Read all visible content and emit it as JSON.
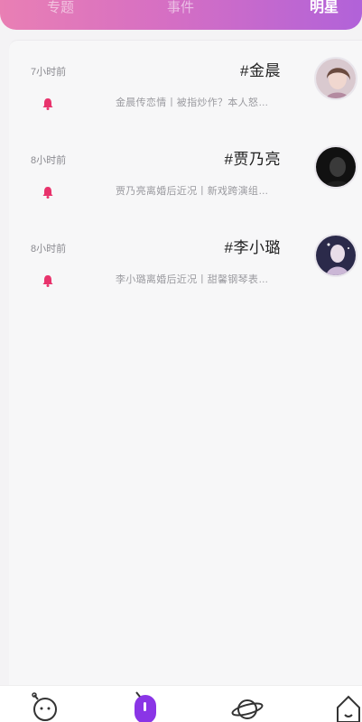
{
  "header": {
    "tabs": [
      {
        "label": "专题",
        "active": false
      },
      {
        "label": "事件",
        "active": false
      },
      {
        "label": "明星",
        "active": true
      }
    ]
  },
  "feed": {
    "items": [
      {
        "title": "#金晨",
        "desc": "金晨传恋情丨被指炒作？本人怒…",
        "time": "7小时前"
      },
      {
        "title": "#贾乃亮",
        "desc": "贾乃亮离婚后近况丨新戏跨演组…",
        "time": "8小时前"
      },
      {
        "title": "#李小璐",
        "desc": "李小璐离婚后近况丨甜馨钢琴表…",
        "time": "8小时前"
      }
    ]
  },
  "bottom_nav": {
    "items": [
      {
        "icon": "face-icon",
        "active": false
      },
      {
        "icon": "capsule-icon",
        "active": true
      },
      {
        "icon": "planet-icon",
        "active": false
      },
      {
        "icon": "home-icon",
        "active": false
      }
    ]
  },
  "colors": {
    "accent": "#e8336c",
    "purple": "#8a35e6",
    "header_gradient_start": "#e97fb4",
    "header_gradient_end": "#b162d9"
  }
}
